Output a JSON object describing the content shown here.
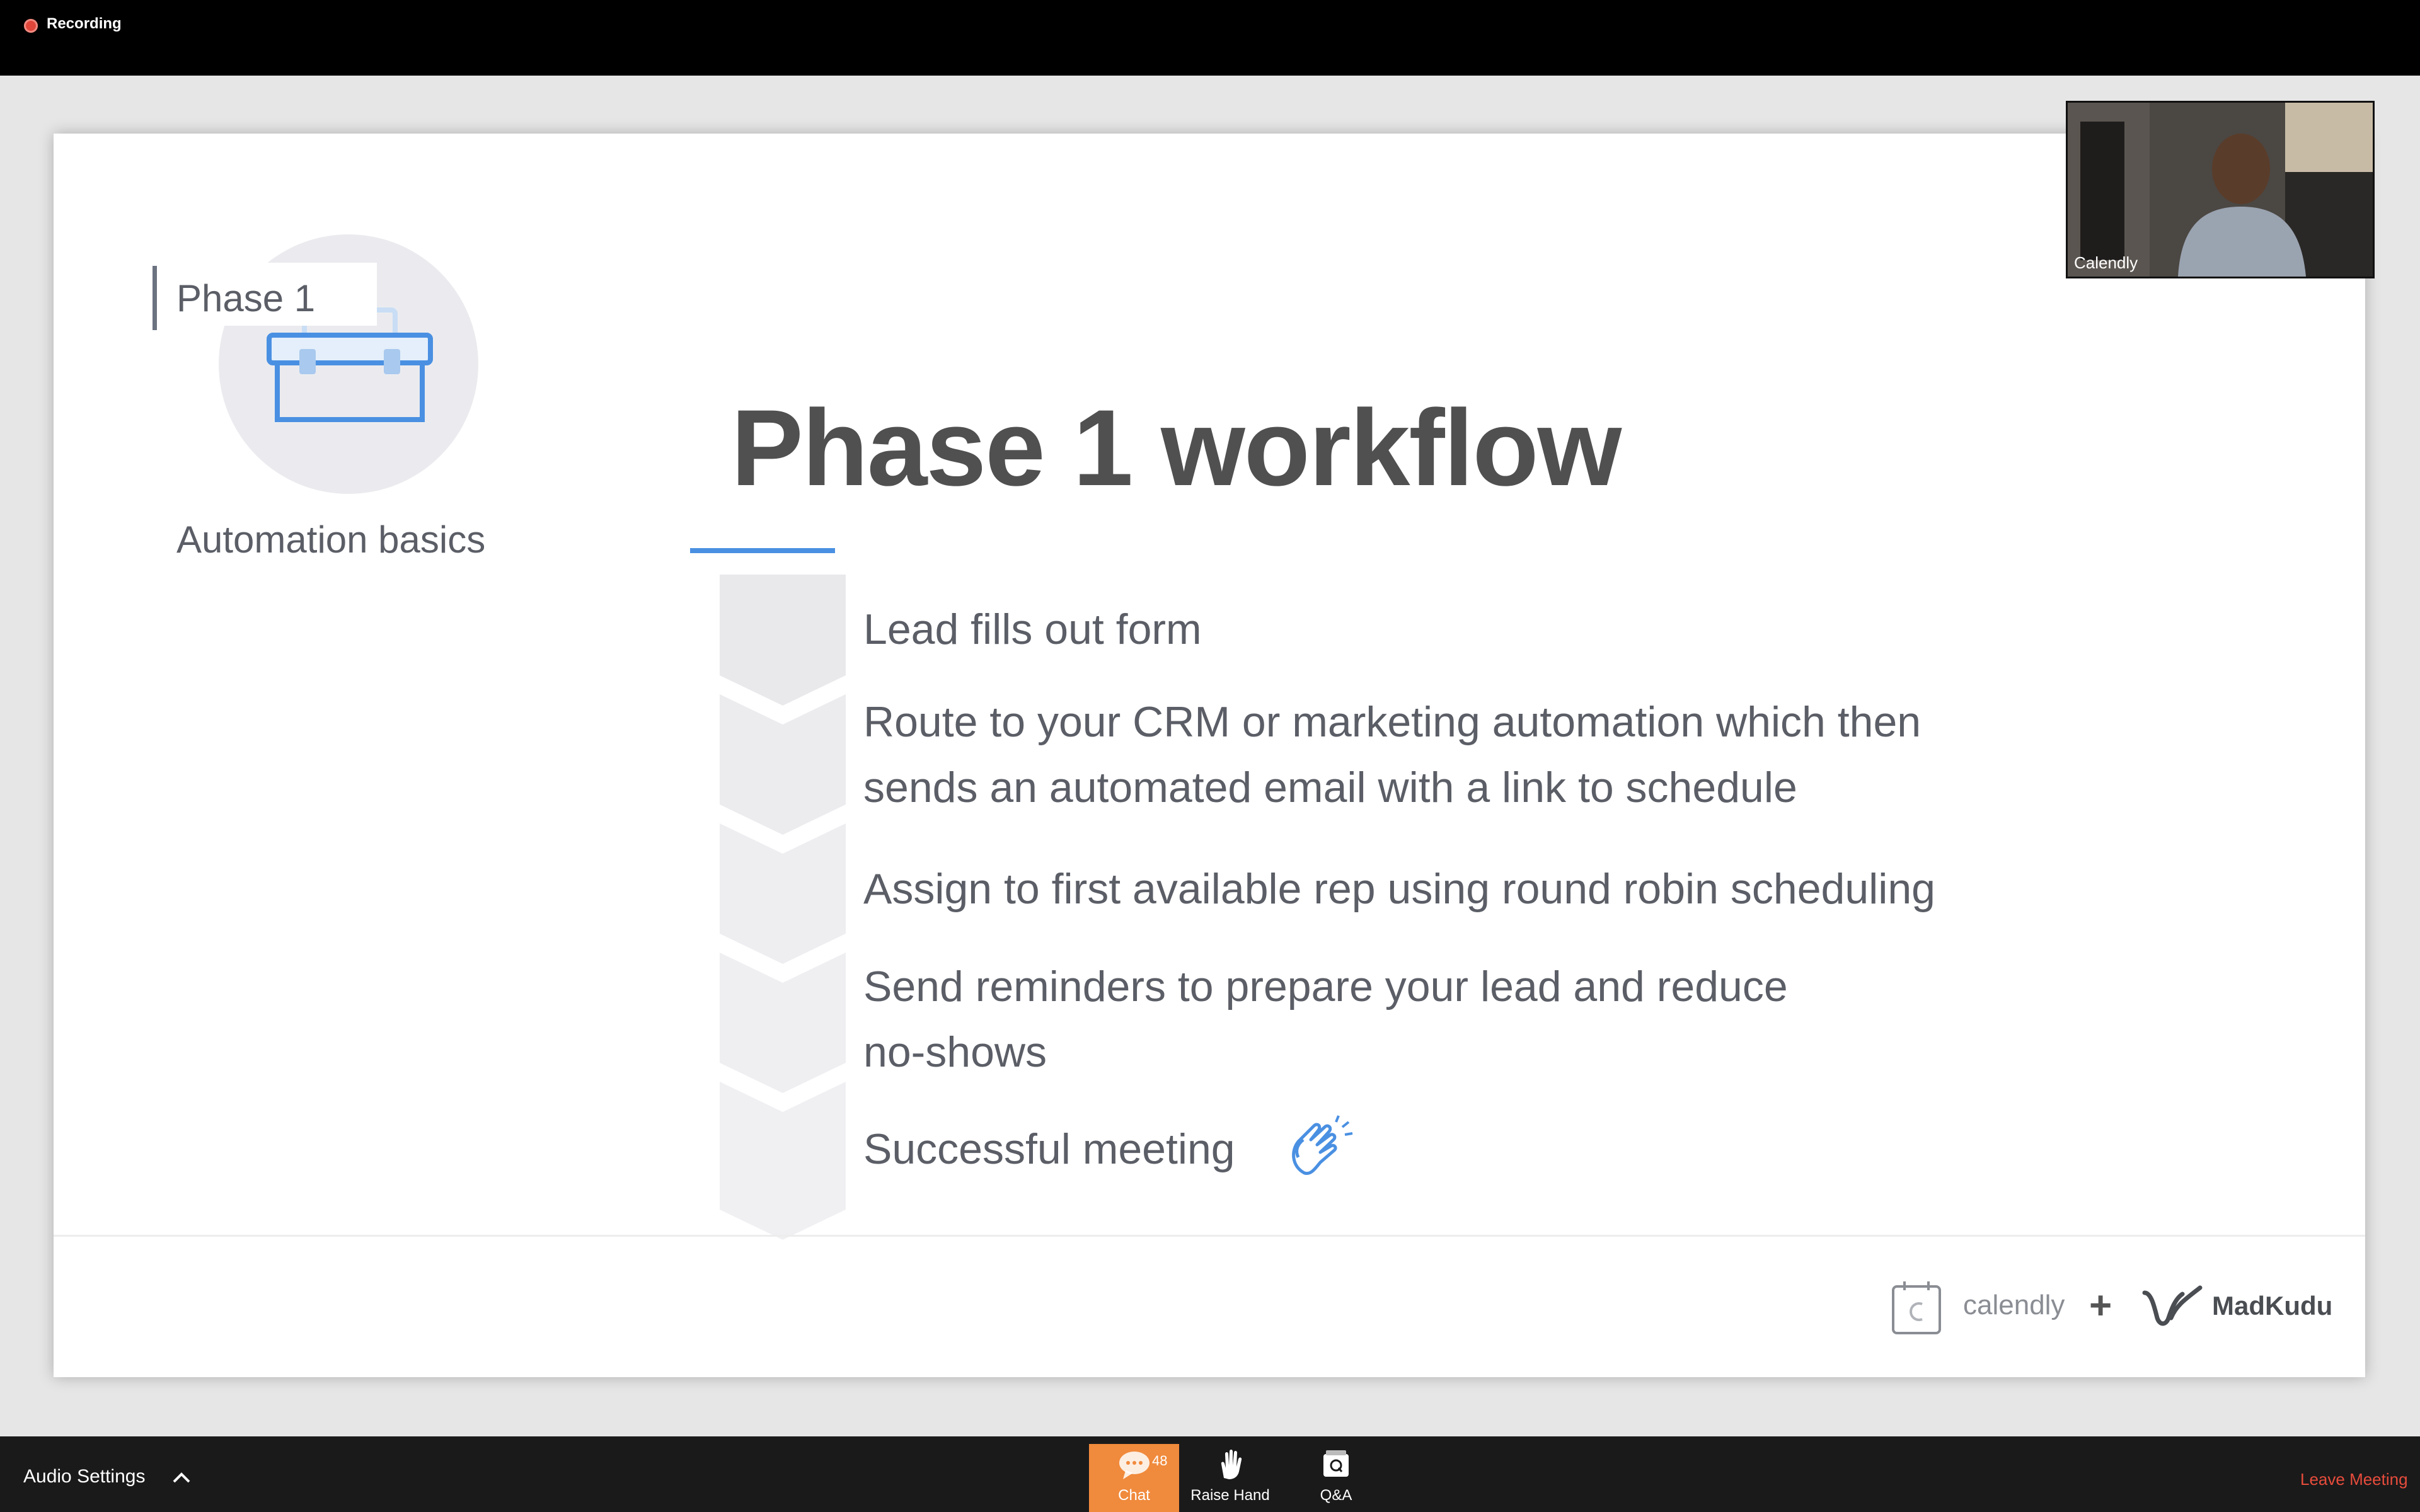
{
  "top_bar": {
    "recording_label": "Recording"
  },
  "slide": {
    "phase_label": "Phase 1",
    "phase_subtitle": "Automation basics",
    "title": "Phase 1 workflow",
    "steps": [
      {
        "line1": "Lead fills out form",
        "line2": ""
      },
      {
        "line1": "Route to your CRM or marketing automation which then",
        "line2": "sends an automated email with a link to schedule"
      },
      {
        "line1": "Assign to first available rep using round robin scheduling",
        "line2": ""
      },
      {
        "line1": "Send reminders to prepare your lead and reduce",
        "line2": "no-shows"
      },
      {
        "line1": "Successful meeting",
        "line2": ""
      }
    ],
    "footer": {
      "calendly_text": "calendly",
      "plus": "+",
      "madkudu_text": "MadKudu"
    },
    "accent_color": "#4a90e2"
  },
  "participant": {
    "name": "Calendly"
  },
  "bottom_bar": {
    "audio_settings": "Audio Settings",
    "chat_label": "Chat",
    "chat_count": "48",
    "raise_hand_label": "Raise Hand",
    "qa_label": "Q&A",
    "leave_label": "Leave Meeting",
    "chat_color": "#f08a3c",
    "leave_color": "#e74c3c"
  }
}
